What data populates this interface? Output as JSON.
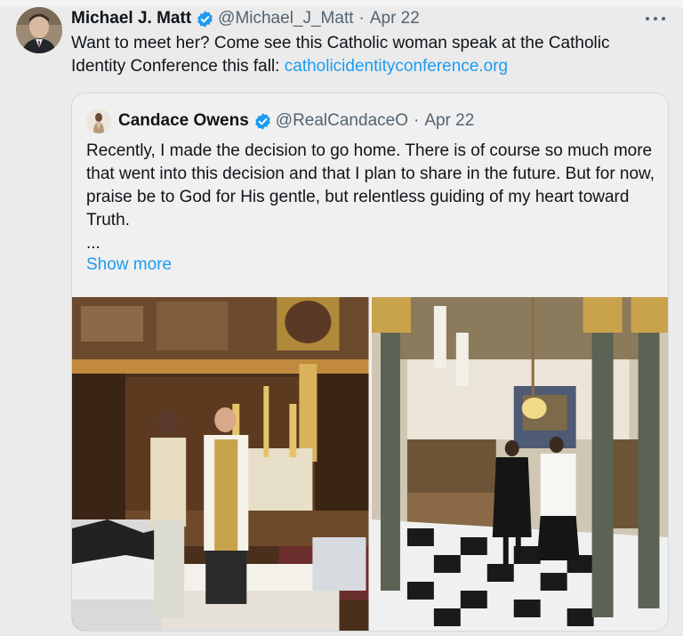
{
  "post": {
    "author_name": "Michael J. Matt",
    "handle": "@Michael_J_Matt",
    "separator": "·",
    "date": "Apr 22",
    "text": "Want to meet her? Come see this Catholic woman speak at the Catholic Identity Conference this fall: ",
    "link_text": "catholicidentityconference.org"
  },
  "quoted_post": {
    "author_name": "Candace Owens",
    "handle": "@RealCandaceO",
    "separator": "·",
    "date": "Apr 22",
    "paragraph": "Recently, I made the decision to go home. There is of course so much more that went into this decision and that I plan to share in the future. But for now, praise be to God for His gentle, but relentless guiding of my heart toward Truth.",
    "ellipsis": "...",
    "show_more": "Show more"
  },
  "icons": {
    "verified": "verified-badge-icon",
    "more": "more-options-icon"
  },
  "colors": {
    "link": "#1d9bf0",
    "verified": "#1d9bf0",
    "secondary_text": "#536471",
    "primary_text": "#0f1419"
  }
}
